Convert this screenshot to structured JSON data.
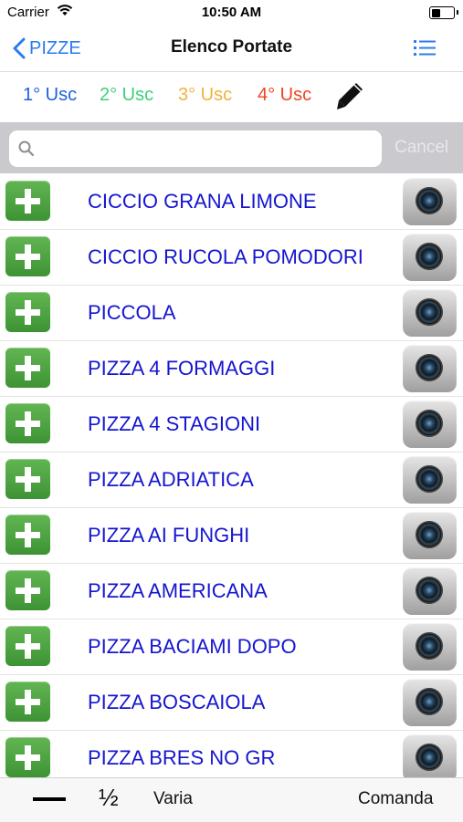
{
  "status_bar": {
    "carrier": "Carrier",
    "time": "10:50 AM"
  },
  "nav": {
    "back_label": "PIZZE",
    "title": "Elenco Portate"
  },
  "uscite": [
    {
      "label": "1° Usc",
      "color": "#1e5fe0"
    },
    {
      "label": "2° Usc",
      "color": "#3fcf7a"
    },
    {
      "label": "3° Usc",
      "color": "#f2b23a"
    },
    {
      "label": "4° Usc",
      "color": "#f04422"
    }
  ],
  "search": {
    "placeholder": "",
    "value": "",
    "cancel_label": "Cancel"
  },
  "items": [
    {
      "name": "CICCIO GRANA LIMONE"
    },
    {
      "name": "CICCIO RUCOLA POMODORI"
    },
    {
      "name": "PICCOLA"
    },
    {
      "name": "PIZZA 4 FORMAGGI"
    },
    {
      "name": "PIZZA 4 STAGIONI"
    },
    {
      "name": "PIZZA ADRIATICA"
    },
    {
      "name": "PIZZA AI FUNGHI"
    },
    {
      "name": "PIZZA AMERICANA"
    },
    {
      "name": "PIZZA BACIAMI DOPO"
    },
    {
      "name": "PIZZA BOSCAIOLA"
    },
    {
      "name": "PIZZA BRES NO GR"
    }
  ],
  "toolbar": {
    "half_label": "½",
    "varia_label": "Varia",
    "comanda_label": "Comanda"
  },
  "icons": {
    "back": "chevron-left-icon",
    "menu": "list-menu-icon",
    "edit": "pencil-icon",
    "search": "search-icon",
    "add": "plus-icon",
    "photo": "camera-icon",
    "minus": "minus-icon"
  }
}
